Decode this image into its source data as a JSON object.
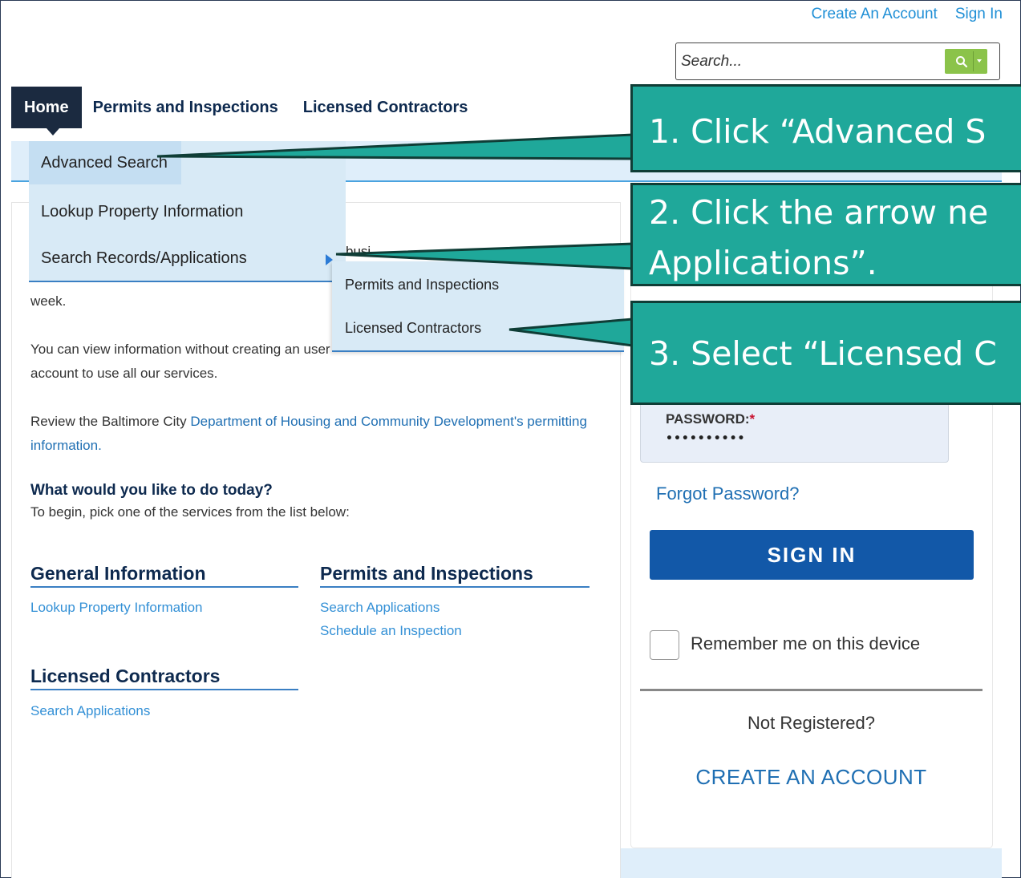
{
  "header": {
    "create_account_link": "Create An Account",
    "sign_in_link": "Sign In",
    "search_placeholder": "Search..."
  },
  "nav": {
    "items": [
      {
        "label": "Home"
      },
      {
        "label": "Permits and Inspections"
      },
      {
        "label": "Licensed Contractors"
      }
    ]
  },
  "dropdown": {
    "items": [
      {
        "label": "Advanced Search"
      },
      {
        "label": "Lookup Property Information"
      },
      {
        "label": "Search Records/Applications"
      }
    ],
    "submenu": [
      {
        "label": "Permits and Inspections"
      },
      {
        "label": "Licensed Contractors"
      }
    ]
  },
  "main": {
    "partial_text": "busi",
    "week_text": "week.",
    "view_text": "You can view information without creating an user account to use all our services.",
    "review_prefix": "Review the Baltimore City ",
    "review_link": "Department of Housing and Community Development's permitting information.",
    "question_title": "What would you like to do today?",
    "question_sub": "To begin, pick one of the services from the list below:",
    "sections": [
      {
        "title": "General Information",
        "links": [
          "Lookup Property Information"
        ]
      },
      {
        "title": "Permits and Inspections",
        "links": [
          "Search Applications",
          "Schedule an Inspection"
        ]
      },
      {
        "title": "Licensed Contractors",
        "links": [
          "Search Applications"
        ]
      }
    ]
  },
  "login": {
    "password_label": "PASSWORD:",
    "password_required": "*",
    "password_value": "••••••••••",
    "forgot_password": "Forgot Password?",
    "sign_in_button": "SIGN IN",
    "remember_me": "Remember me on this device",
    "not_registered": "Not Registered?",
    "create_account": "CREATE AN ACCOUNT"
  },
  "callouts": {
    "step1": "1. Click “Advanced S",
    "step2_line1": "2. Click the arrow ne",
    "step2_line2": "Applications”.",
    "step3": "3. Select “Licensed C"
  },
  "colors": {
    "callout_fill": "#1fa89a",
    "callout_border": "#0f3d36",
    "nav_active": "#1b2a40",
    "link_blue": "#1f6fb3",
    "sign_in_blue": "#1258a8",
    "search_green": "#8bc34a"
  }
}
